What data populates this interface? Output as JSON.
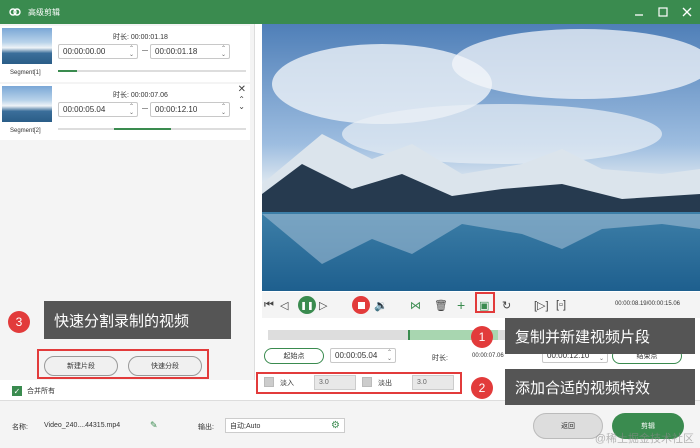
{
  "window": {
    "title": "高级剪辑"
  },
  "segments": [
    {
      "label": "Segment[1]",
      "duration_label": "时长:",
      "duration": "00:00:01.18",
      "start": "00:00:00.00",
      "end": "00:00:01.18",
      "progress": 0.1
    },
    {
      "label": "Segment[2]",
      "duration_label": "时长:",
      "duration": "00:00:07.06",
      "start": "00:00:05.04",
      "end": "00:00:12.10",
      "progress": 0.6
    }
  ],
  "player": {
    "timecode": "00:00:08.19/00:00:15.06"
  },
  "timeline": {
    "start_button": "起始点",
    "start_time": "00:00:05.04",
    "duration_label": "时长:",
    "duration": "00:00:07.06",
    "end_time": "00:00:12.10",
    "end_button": "结束点"
  },
  "effects": {
    "fade_in_label": "淡入",
    "fade_in_value": "3.0",
    "fade_out_label": "淡出",
    "fade_out_value": "3.0"
  },
  "left_actions": {
    "new_segment": "新建片段",
    "quick_split": "快速分段",
    "merge_all": "合并所有"
  },
  "footer": {
    "name_label": "名称:",
    "file_name": "Video_240....44315.mp4",
    "output_label": "输出:",
    "output_value": "自动;Auto",
    "back_button": "返回",
    "cut_button": "剪辑",
    "watermark": "@稀土掘金技术社区"
  },
  "annotations": [
    {
      "num": "1",
      "text": "复制并新建视频片段"
    },
    {
      "num": "2",
      "text": "添加合适的视频特效"
    },
    {
      "num": "3",
      "text": "快速分割录制的视频"
    }
  ],
  "colors": {
    "brand": "#3a8b4f",
    "annotation_red": "#e23b3b",
    "callout_bg": "#555555"
  }
}
